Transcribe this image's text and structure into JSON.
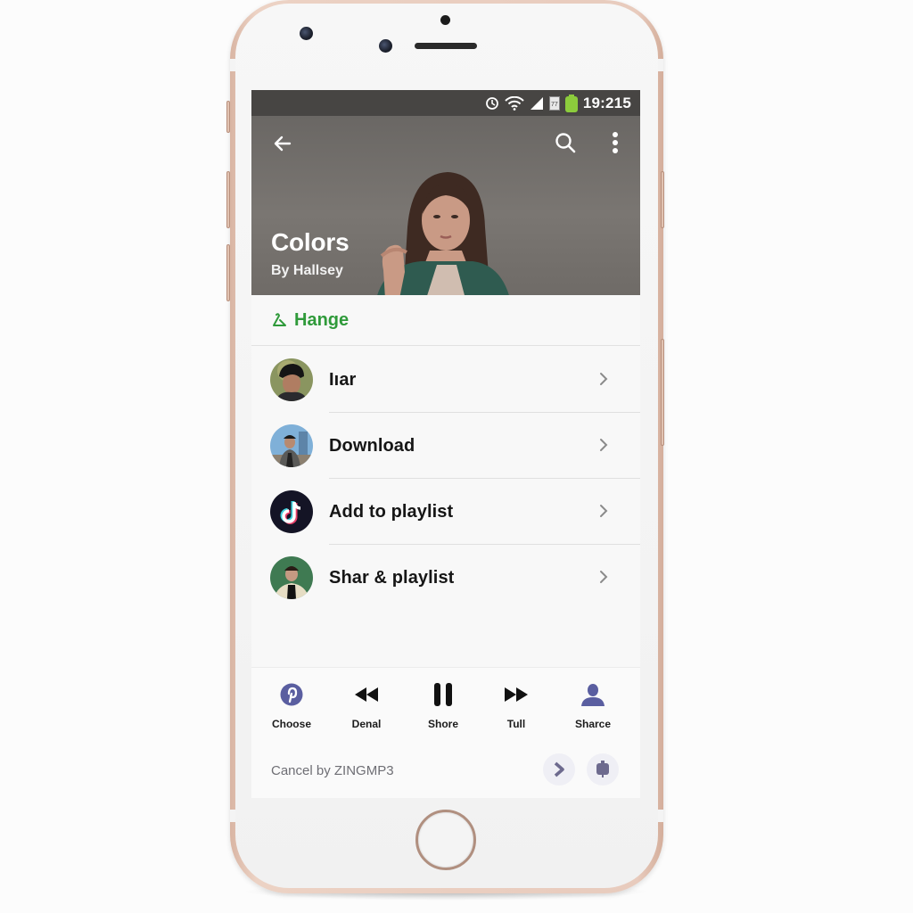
{
  "status_bar": {
    "time": "19:215",
    "icons": [
      "alarm-icon",
      "wifi-icon",
      "signal-icon",
      "sim-icon",
      "battery-icon"
    ],
    "battery_color": "#8ccc3c"
  },
  "header": {
    "back_icon": "arrow-left-icon",
    "search_icon": "search-icon",
    "more_icon": "more-vertical-icon",
    "title": "Colors",
    "subtitle": "By Hallsey"
  },
  "action_row": {
    "icon": "hanger-icon",
    "label": "Hange",
    "color": "#2f9a3a"
  },
  "menu": {
    "items": [
      {
        "label": "Iıar",
        "avatar": "avatar-man-bucket-hat"
      },
      {
        "label": "Download",
        "avatar": "avatar-man-city"
      },
      {
        "label": "Add to playlist",
        "avatar": "tiktok-logo"
      },
      {
        "label": "Shar & playlist",
        "avatar": "avatar-man-green-bg"
      }
    ],
    "chevron_icon": "chevron-right-icon"
  },
  "player": {
    "controls": [
      {
        "label": "Choose",
        "icon": "pinterest-icon"
      },
      {
        "label": "Denal",
        "icon": "rewind-icon"
      },
      {
        "label": "Shore",
        "icon": "pause-icon"
      },
      {
        "label": "Tull",
        "icon": "fast-forward-icon"
      },
      {
        "label": "Sharce",
        "icon": "user-icon"
      }
    ],
    "accent": "#5a5ea0"
  },
  "footer": {
    "text": "Cancel by ZINGMP3",
    "next_icon": "chevron-right-icon",
    "cast_icon": "device-icon"
  }
}
